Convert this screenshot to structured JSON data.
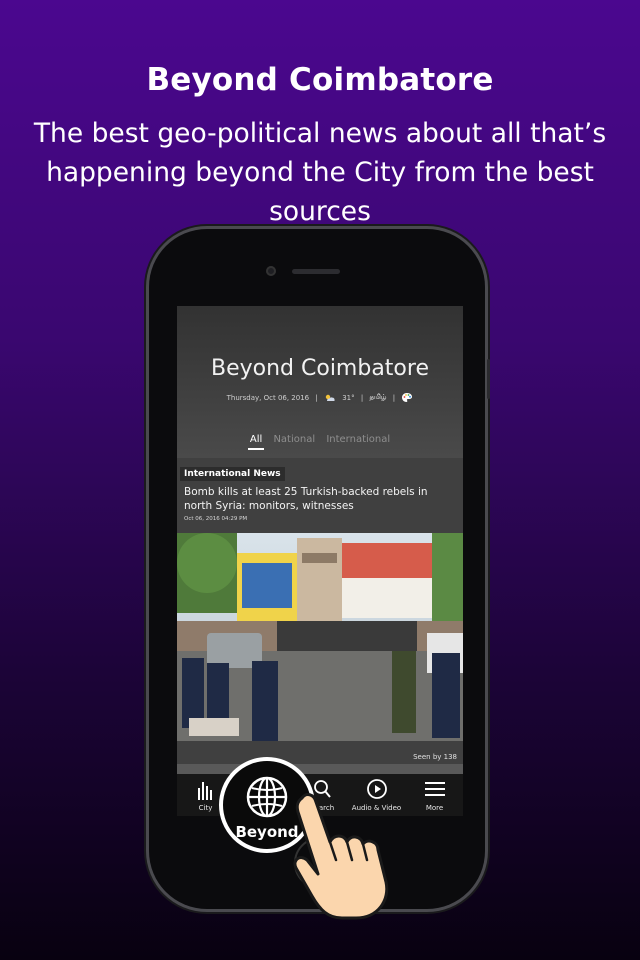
{
  "promo": {
    "title": "Beyond Coimbatore",
    "subtitle_line1": "The best geo-political news about all that’s",
    "subtitle_line2": "happening beyond the City from the best sources"
  },
  "app": {
    "title": "Beyond Coimbatore",
    "date": "Thursday, Oct 06, 2016",
    "temperature": "31°",
    "language": "தமிழ்",
    "separator": "|",
    "tabs": [
      {
        "label": "All",
        "active": true
      },
      {
        "label": "National",
        "active": false
      },
      {
        "label": "International",
        "active": false
      }
    ]
  },
  "article": {
    "category": "International News",
    "headline": "Bomb kills at least 25 Turkish-backed rebels in north Syria: monitors, witnesses",
    "timestamp": "Oct 06, 2016 04:29 PM",
    "seen": "Seen by 138"
  },
  "bottom_nav": {
    "items": [
      {
        "label": "City",
        "icon": "bars-icon"
      },
      {
        "label": "Beyond",
        "icon": "globe-icon"
      },
      {
        "label": "Search",
        "icon": "search-icon"
      },
      {
        "label": "Audio & Video",
        "icon": "play-icon"
      },
      {
        "label": "More",
        "icon": "menu-icon"
      }
    ],
    "search_fragment": "arch"
  },
  "colors": {
    "background_top": "#4b078f",
    "background_bottom": "#080110",
    "nav_bg": "#171717"
  }
}
